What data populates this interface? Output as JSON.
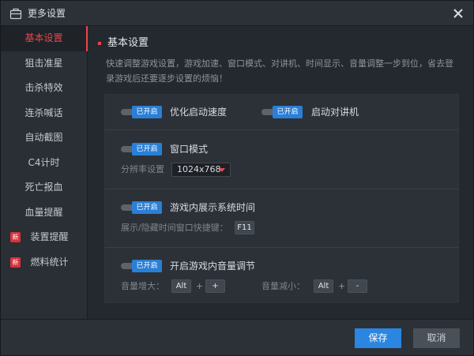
{
  "window": {
    "title": "更多设置",
    "title_icon": "settings-box-icon",
    "close_icon": "close-icon"
  },
  "sidebar": {
    "items": [
      {
        "label": "基本设置",
        "active": true
      },
      {
        "label": "狙击准星"
      },
      {
        "label": "击杀特效"
      },
      {
        "label": "连杀喊话"
      },
      {
        "label": "自动截图"
      },
      {
        "label": "C4计时"
      },
      {
        "label": "死亡报血"
      },
      {
        "label": "血量提醒"
      },
      {
        "label": "装置提醒",
        "badge": "新"
      },
      {
        "label": "燃料统计",
        "badge": "新"
      }
    ]
  },
  "main": {
    "section_title": "基本设置",
    "description": "快速调整游戏设置，游戏加速、窗口模式、对讲机、时间显示、音量调整一步到位，省去登录游戏后还要逐步设置的烦恼！",
    "toggle_on_text": "已开启",
    "rows": {
      "row1": {
        "optimize_label": "优化启动速度",
        "intercom_label": "启动对讲机"
      },
      "row2": {
        "window_mode_label": "窗口模式",
        "resolution_label": "分辨率设置",
        "resolution_value": "1024x768"
      },
      "row3": {
        "show_time_label": "游戏内展示系统时间",
        "hotkey_label": "展示/隐藏时间窗口快捷键：",
        "hotkey_value": "F11"
      },
      "row4": {
        "volume_label": "开启游戏内音量调节",
        "vol_up_label": "音量增大：",
        "vol_up_key1": "Alt",
        "vol_up_key2": "+",
        "vol_down_label": "音量减小：",
        "vol_down_key1": "Alt",
        "vol_down_key2": "-",
        "plus_sign": "+"
      }
    }
  },
  "footer": {
    "save_label": "保存",
    "cancel_label": "取消"
  },
  "colors": {
    "accent": "#e8464b",
    "primary": "#2a86e0",
    "toggle": "#2a7fd6",
    "background": "#24292f"
  }
}
